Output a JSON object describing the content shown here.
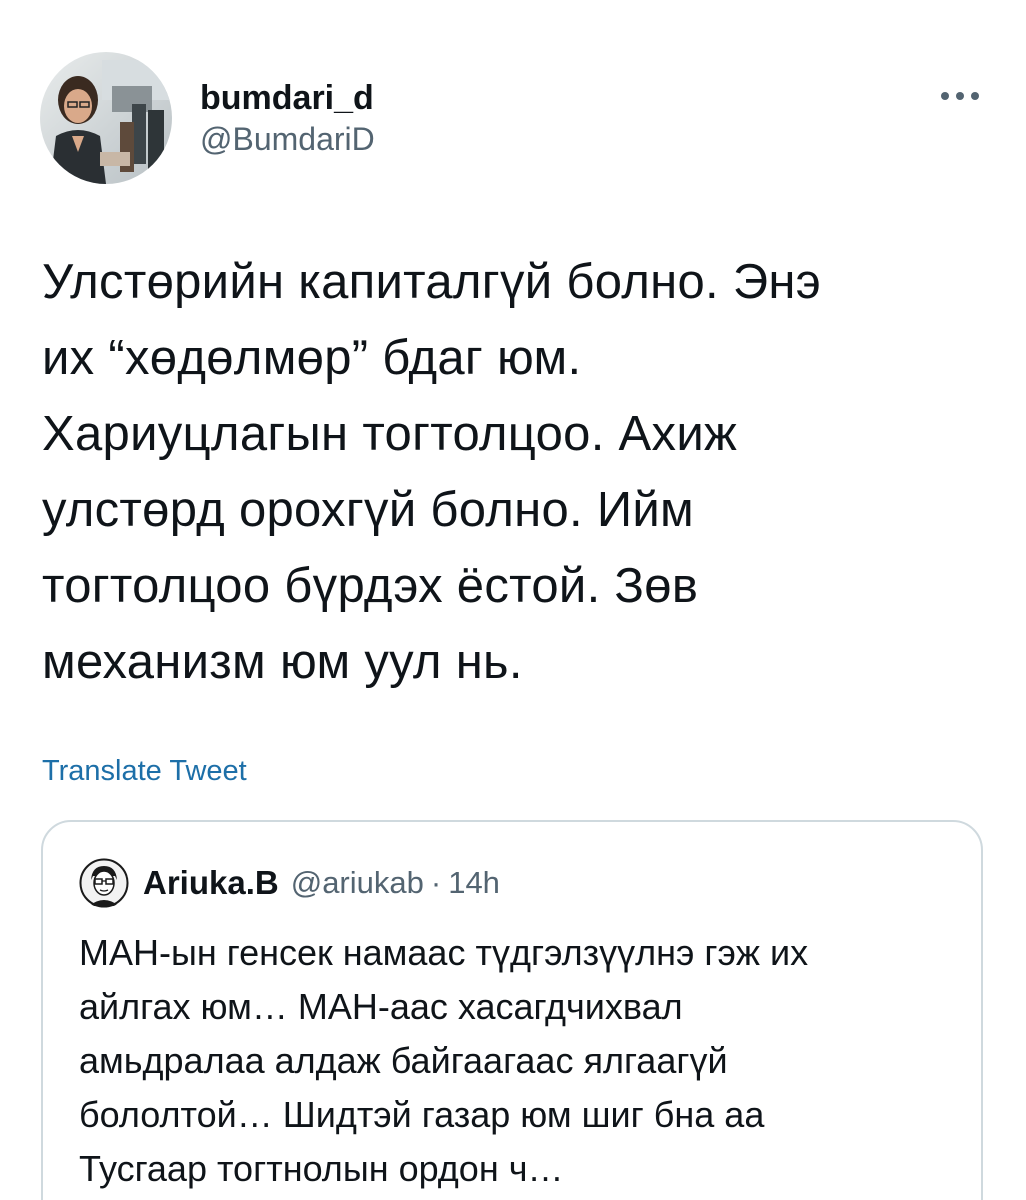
{
  "tweet": {
    "author": {
      "display_name": "bumdari_d",
      "handle": "@BumdariD"
    },
    "more_icon": "more-horizontal-icon",
    "text": "Улстөрийн капиталгүй болно. Энэ\nих “хөдөлмөр” бдаг юм.\nХариуцлагын тогтолцоо. Ахиж\nулстөрд орохгүй болно. Ийм\nтогтолцоо бүрдэх ёстой. Зөв\nмеханизм юм уул нь.",
    "translate_label": "Translate Tweet"
  },
  "quote": {
    "author": {
      "display_name": "Ariuka.B",
      "handle": "@ariukab",
      "separator": "·",
      "time": "14h"
    },
    "text": "МАН-ын генсек намаас түдгэлзүүлнэ гэж их\nайлгах юм… МАН-аас хасагдчихвал\nамьдралаа алдаж байгаагаас ялгаагүй\nбололтой… Шидтэй газар юм шиг бна аа\nТусгаар тогтнолын ордон ч…"
  },
  "colors": {
    "text_primary": "#0f1419",
    "text_secondary": "#536471",
    "link": "#1d6fa8",
    "border": "#cfd9de",
    "background": "#ffffff"
  }
}
